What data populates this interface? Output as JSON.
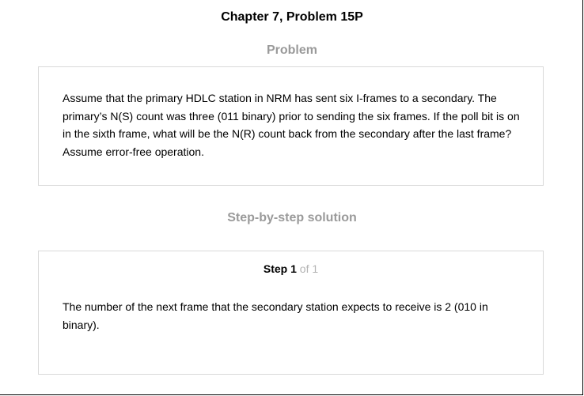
{
  "header": {
    "title": "Chapter 7, Problem 15P"
  },
  "problem": {
    "heading": "Problem",
    "text": "Assume that the primary HDLC station in NRM has sent six I-frames to a secondary. The primary’s N(S) count was three (011 binary) prior to sending the six frames. If the poll bit is on in the sixth frame, what will be the N(R) count back from the secondary after the last frame? Assume error-free operation."
  },
  "solution": {
    "heading": "Step-by-step solution",
    "step_word": "Step",
    "step_number": "1",
    "step_total": "of 1",
    "text": "The number of the next frame that the secondary station expects to receive is 2 (010 in binary)."
  }
}
